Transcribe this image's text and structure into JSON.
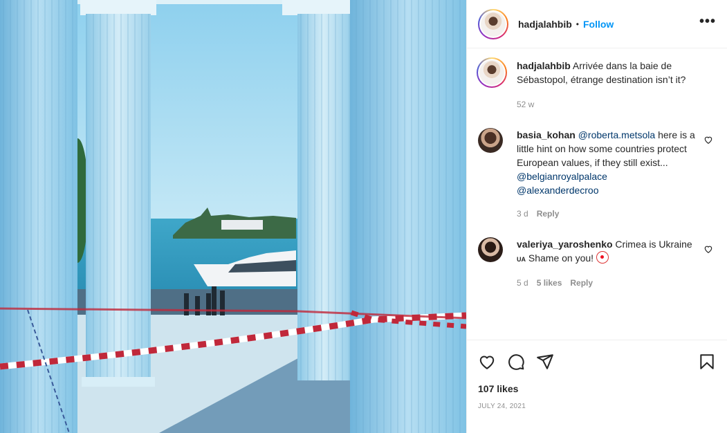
{
  "post": {
    "author": "hadjalahbib",
    "separator": "•",
    "follow_label": "Follow",
    "more_label": "•••"
  },
  "caption": {
    "user": "hadjalahbib",
    "text": "Arrivée dans la baie de Sébastopol, étrange destination isn’t it?",
    "time": "52 w"
  },
  "comments": [
    {
      "user": "basia_kohan",
      "mention1": "@roberta.metsola",
      "text": " here is a little hint on how some countries protect European values, if they still exist...",
      "mention2": "@belgianroyalpalace",
      "mention3": "@alexanderdecroo",
      "time": "3 d",
      "reply_label": "Reply"
    },
    {
      "user": "valeriya_yaroshenko",
      "text": "Crimea is Ukraine",
      "flag": "UA",
      "text2": " Shame on you!",
      "time": "5 d",
      "likes_label": "5 likes",
      "reply_label": "Reply"
    }
  ],
  "footer": {
    "likes": "107 likes",
    "date": "JULY 24, 2021"
  },
  "icons": {
    "like": "heart-icon",
    "comment": "comment-icon",
    "share": "share-icon",
    "save": "bookmark-icon",
    "more": "more-icon"
  },
  "colors": {
    "accent": "#0095f6",
    "mention": "#00376b",
    "meta": "#8e8e8e",
    "text": "#262626"
  }
}
